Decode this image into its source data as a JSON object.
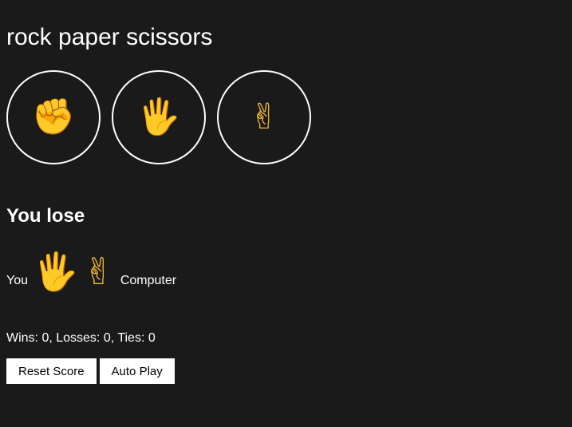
{
  "page": {
    "title": "rock paper scissors"
  },
  "moves": [
    {
      "name": "rock",
      "icon": "raised-fist",
      "glyph": "✊"
    },
    {
      "name": "paper",
      "icon": "raised-hand",
      "glyph": "🖐"
    },
    {
      "name": "scissors",
      "icon": "victory-hand",
      "glyph": "✌"
    }
  ],
  "result": {
    "text": "You lose"
  },
  "played": {
    "you_label": "You",
    "you_glyph": "🖐",
    "computer_glyph": "✌",
    "computer_label": "Computer"
  },
  "score": {
    "text": "Wins: 0, Losses: 0, Ties: 0"
  },
  "actions": {
    "reset_label": "Reset Score",
    "auto_play_label": "Auto Play"
  },
  "colors": {
    "background": "#1a1a1a",
    "text": "#ffffff",
    "emoji": "#f5b935"
  }
}
